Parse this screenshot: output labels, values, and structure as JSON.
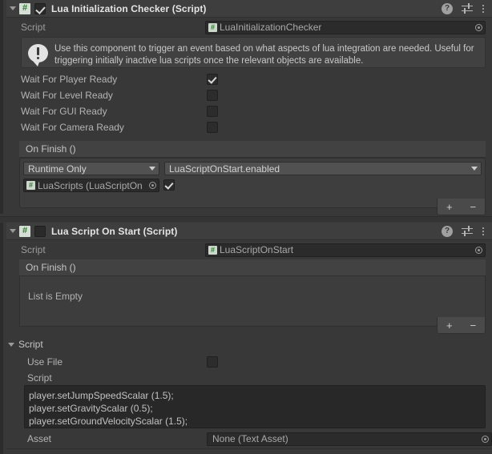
{
  "theme": {
    "bg": "#383838",
    "header_bg": "#3e3e3e",
    "field_bg": "#2b2b2b",
    "text": "#c4c4c4",
    "accent_script_icon": "#2e7a2e"
  },
  "components": [
    {
      "title": "Lua Initialization Checker (Script)",
      "enabled": true,
      "foldout_open": true,
      "icons": {
        "foldout": "triangle-down-icon",
        "component": "script-icon",
        "hash_glyph": "#",
        "help": "help-icon",
        "preset": "preset-icon",
        "menu": "kebab-menu-icon"
      },
      "script_row": {
        "label": "Script",
        "value": "LuaInitializationChecker",
        "picker": "object-picker-icon"
      },
      "help_box": {
        "icon": "info-exclamation-icon",
        "text": "Use this component to trigger an event based on what aspects of lua integration are needed. Useful for triggering initially inactive lua scripts once the relevant objects are available."
      },
      "toggles": [
        {
          "label": "Wait For Player Ready",
          "checked": true
        },
        {
          "label": "Wait For Level Ready",
          "checked": false
        },
        {
          "label": "Wait For GUI Ready",
          "checked": false
        },
        {
          "label": "Wait For Camera Ready",
          "checked": false
        }
      ],
      "event": {
        "title": "On Finish ()",
        "entries": [
          {
            "mode": "Runtime Only",
            "function": "LuaScriptOnStart.enabled",
            "target": "LuaScripts (LuaScriptOn",
            "bool_arg": true
          }
        ],
        "add_label": "+",
        "remove_label": "−"
      }
    },
    {
      "title": "Lua Script On Start (Script)",
      "enabled": false,
      "foldout_open": true,
      "script_row": {
        "label": "Script",
        "value": "LuaScriptOnStart",
        "picker": "object-picker-icon"
      },
      "event": {
        "title": "On Finish ()",
        "empty_text": "List is Empty",
        "add_label": "+",
        "remove_label": "−"
      },
      "script_section": {
        "title": "Script",
        "use_file": {
          "label": "Use File",
          "checked": false
        },
        "script_label": "Script",
        "script_text": "player.setJumpSpeedScalar (1.5);\nplayer.setGravityScalar (0.5);\nplayer.setGroundVelocityScalar (1.5);",
        "asset": {
          "label": "Asset",
          "value": "None (Text Asset)",
          "picker": "object-picker-icon"
        }
      }
    }
  ]
}
